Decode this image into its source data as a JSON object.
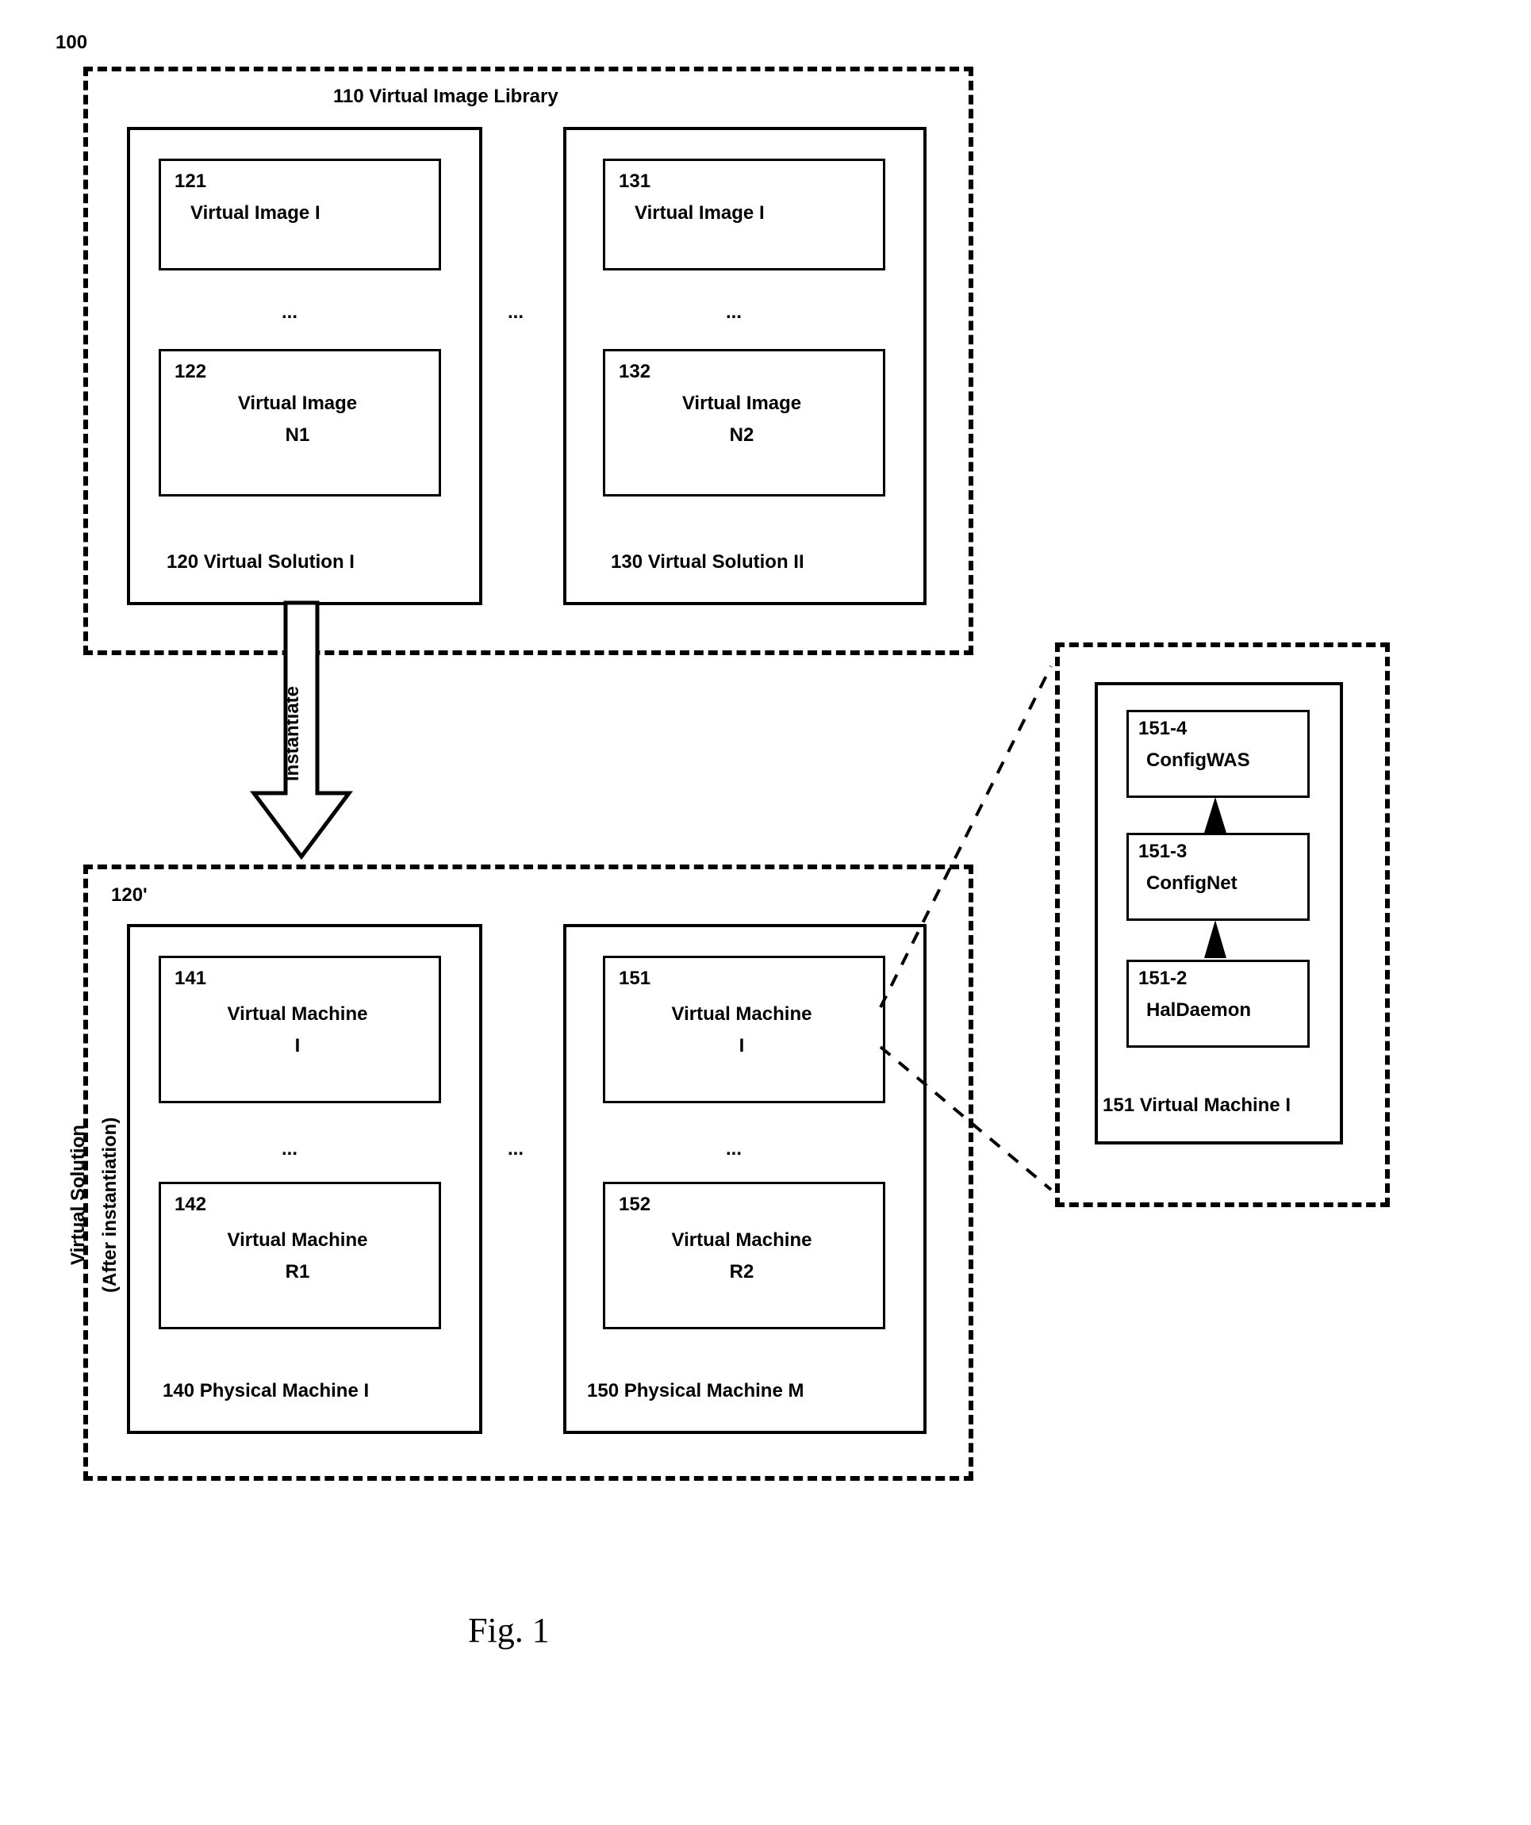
{
  "figure": "Fig. 1",
  "label100": "100",
  "library": {
    "numtitle": "110 Virtual Image Library"
  },
  "sol1": {
    "img1_ref": "121",
    "img1_label": "Virtual Image I",
    "dots": "...",
    "img2_ref": "122",
    "img2_label_l1": "Virtual Image",
    "img2_label_l2": "N1",
    "caption": "120  Virtual Solution I"
  },
  "between_sol_dots": "...",
  "sol2": {
    "img1_ref": "131",
    "img1_label": "Virtual Image I",
    "dots": "...",
    "img2_ref": "132",
    "img2_label_l1": "Virtual Image",
    "img2_label_l2": "N2",
    "caption": "130  Virtual Solution II"
  },
  "instantiate_label": "Instantiate",
  "lower_ref": "120'",
  "lower_side_l1": "Virtual Solution",
  "lower_side_l2": "(After instantiation)",
  "pm1": {
    "vm1_ref": "141",
    "vm1_l1": "Virtual Machine",
    "vm1_l2": "I",
    "dots": "...",
    "vm2_ref": "142",
    "vm2_l1": "Virtual Machine",
    "vm2_l2": "R1",
    "caption": "140  Physical Machine I"
  },
  "between_pm_dots": "...",
  "pm2": {
    "vm1_ref": "151",
    "vm1_l1": "Virtual Machine",
    "vm1_l2": "I",
    "dots": "...",
    "vm2_ref": "152",
    "vm2_l1": "Virtual Machine",
    "vm2_l2": "R2",
    "caption": "150  Physical Machine M"
  },
  "detail": {
    "c4_ref": "151-4",
    "c4_label": "ConfigWAS",
    "c3_ref": "151-3",
    "c3_label": "ConfigNet",
    "c2_ref": "151-2",
    "c2_label": "HalDaemon",
    "caption": "151 Virtual Machine I"
  }
}
